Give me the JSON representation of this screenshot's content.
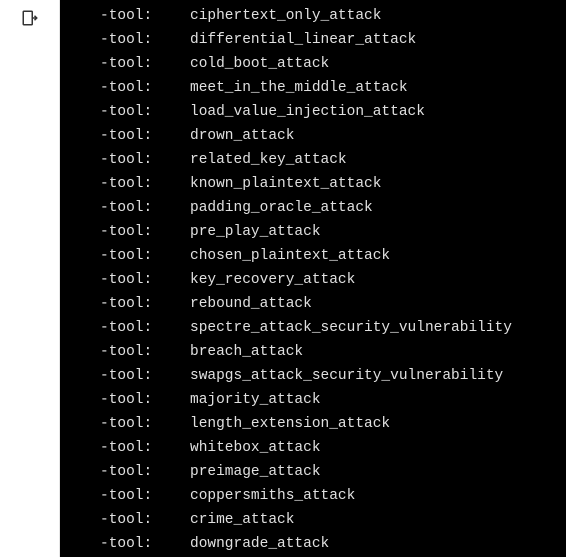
{
  "sidebar": {
    "exit_icon_label": "exit"
  },
  "terminal": {
    "prefix": "-tool:",
    "lines": [
      "ciphertext_only_attack",
      "differential_linear_attack",
      "cold_boot_attack",
      "meet_in_the_middle_attack",
      "load_value_injection_attack",
      "drown_attack",
      "related_key_attack",
      "known_plaintext_attack",
      "padding_oracle_attack",
      "pre_play_attack",
      "chosen_plaintext_attack",
      "key_recovery_attack",
      "rebound_attack",
      "spectre_attack_security_vulnerability",
      "breach_attack",
      "swapgs_attack_security_vulnerability",
      "majority_attack",
      "length_extension_attack",
      "whitebox_attack",
      "preimage_attack",
      "coppersmiths_attack",
      "crime_attack",
      "downgrade_attack"
    ]
  }
}
